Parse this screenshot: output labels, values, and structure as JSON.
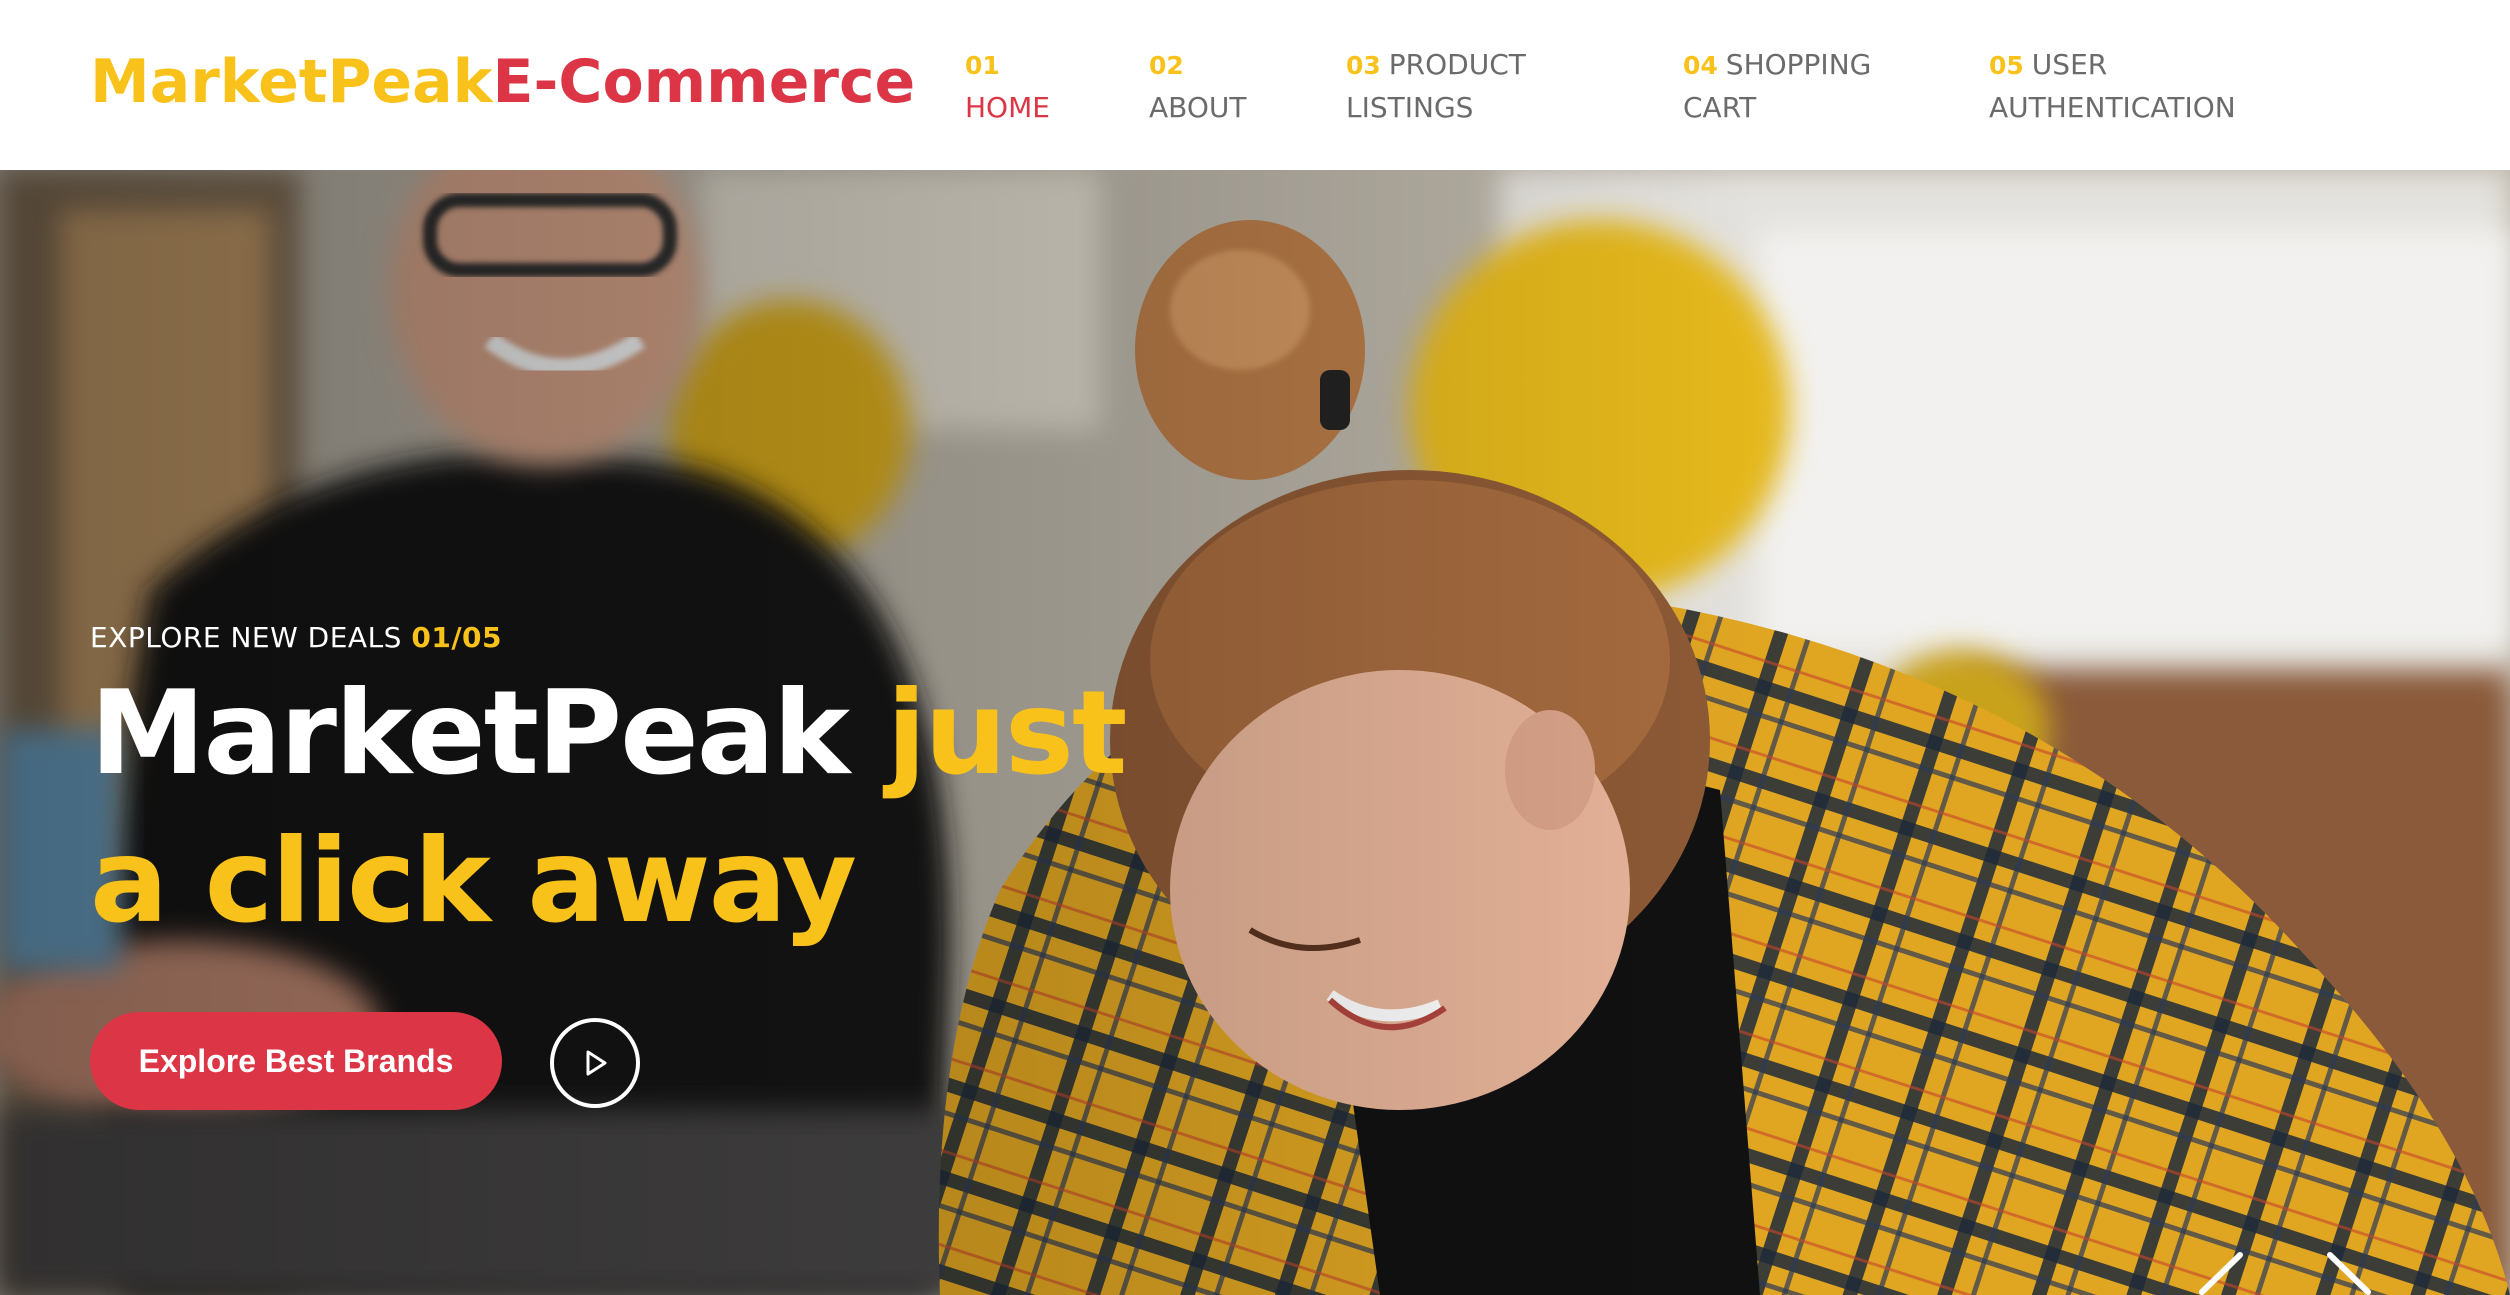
{
  "brand": {
    "name": "MarketPeak",
    "suffix": "E-Commerce"
  },
  "nav": {
    "items": [
      {
        "num": "01",
        "line1": "HOME",
        "line2": "",
        "active": true
      },
      {
        "num": "02",
        "line1": "ABOUT",
        "line2": "",
        "active": false
      },
      {
        "num": "03",
        "line1": "PRODUCT",
        "line2": "LISTINGS",
        "active": false
      },
      {
        "num": "04",
        "line1": "SHOPPING",
        "line2": "CART",
        "active": false
      },
      {
        "num": "05",
        "line1": "USER",
        "line2": "AUTHENTICATION",
        "active": false
      }
    ]
  },
  "hero": {
    "eyebrow": "EXPLORE NEW DEALS",
    "slide_counter": "01/05",
    "headline_white": "MarketPeak",
    "headline_accent": "just a click away",
    "cta_label": "Explore Best Brands",
    "play_icon": "play-icon",
    "prev_icon": "chevron-left-icon",
    "next_icon": "chevron-right-icon"
  },
  "colors": {
    "accent_yellow": "#f9c21a",
    "accent_red": "#dc3545",
    "nav_text": "#6b6b6b"
  }
}
